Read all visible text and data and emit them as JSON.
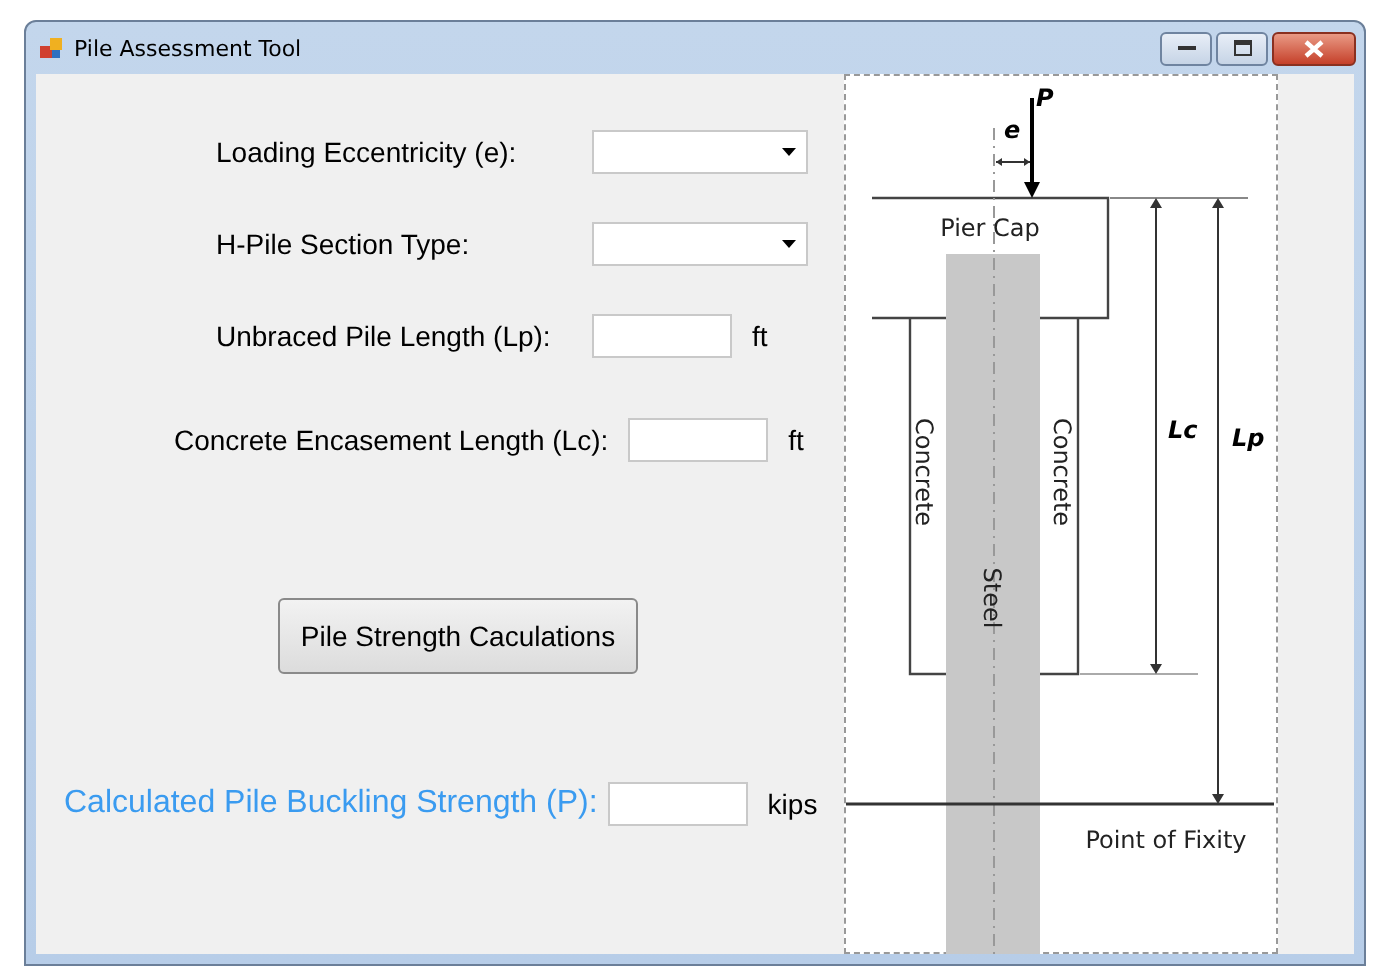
{
  "window": {
    "title": "Pile Assessment Tool"
  },
  "fields": [
    {
      "label": "Loading Eccentricity (e):",
      "kind": "dropdown"
    },
    {
      "label": "H-Pile Section Type:",
      "kind": "dropdown"
    },
    {
      "label": "Unbraced Pile Length (Lp):",
      "kind": "text",
      "unit": "ft"
    },
    {
      "label": "Concrete Encasement Length (Lc):",
      "kind": "text",
      "unit": "ft"
    }
  ],
  "button": "Pile Strength Caculations",
  "result": {
    "label": "Calculated Pile Buckling Strength (P):",
    "unit": "kips"
  },
  "diagram": {
    "load": "P",
    "eccentricity": "e",
    "cap": "Pier Cap",
    "encasement_left": "Concrete",
    "encasement_right": "Concrete",
    "steel": "Steel",
    "lc": "Lc",
    "lp": "Lp",
    "fixity": "Point of Fixity"
  }
}
